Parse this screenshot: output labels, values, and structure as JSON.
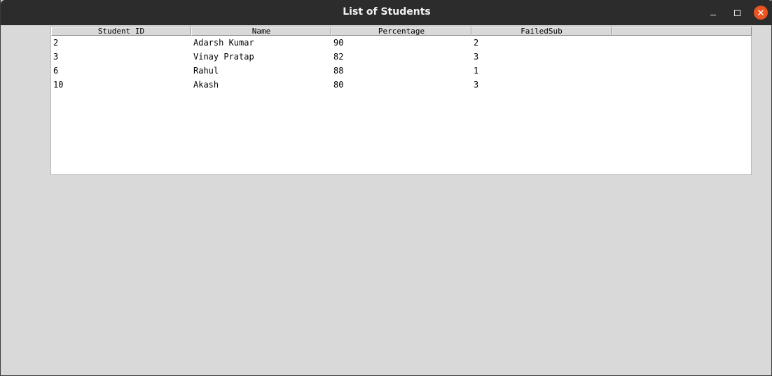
{
  "window": {
    "title": "List of Students",
    "controls": {
      "minimize": "minimize",
      "maximize": "maximize",
      "close": "close"
    },
    "close_color": "#e95420"
  },
  "table": {
    "columns": [
      "Student ID",
      "Name",
      "Percentage",
      "FailedSub",
      ""
    ],
    "rows": [
      [
        "2",
        "Adarsh Kumar",
        "90",
        "2"
      ],
      [
        "3",
        "Vinay Pratap",
        "82",
        "3"
      ],
      [
        "6",
        "Rahul",
        "88",
        "1"
      ],
      [
        "10",
        "Akash",
        "80",
        "3"
      ]
    ]
  }
}
